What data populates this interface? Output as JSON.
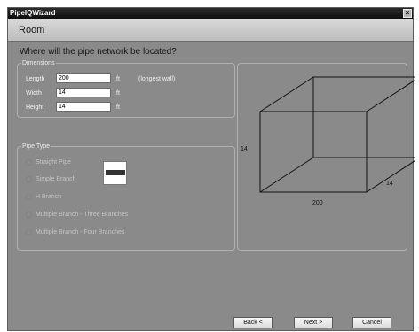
{
  "window": {
    "title": "PipeIQWizard",
    "close_glyph": "×"
  },
  "header": {
    "title": "Room"
  },
  "question": "Where will the pipe network be located?",
  "dimensions": {
    "legend": "Dimensions",
    "length": {
      "label": "Length",
      "value": "200",
      "unit": "ft",
      "note": "(longest wall)"
    },
    "width": {
      "label": "Width",
      "value": "14",
      "unit": "ft"
    },
    "height": {
      "label": "Height",
      "value": "14",
      "unit": "ft"
    }
  },
  "pipe_type": {
    "legend": "Pipe Type",
    "options": [
      "Straight Pipe",
      "Simple Branch",
      "H Branch",
      "Multiple Branch - Three Branches",
      "Multiple Branch - Four Branches"
    ]
  },
  "room_preview": {
    "height_label": "14",
    "depth_label": "14",
    "length_label": "200"
  },
  "buttons": {
    "back": "Back <",
    "next": "Next >",
    "cancel": "Cancel"
  },
  "colors": {
    "panel": "#8a8a8a",
    "title_bar": "#1c1c1c",
    "header": "#cccccc"
  }
}
